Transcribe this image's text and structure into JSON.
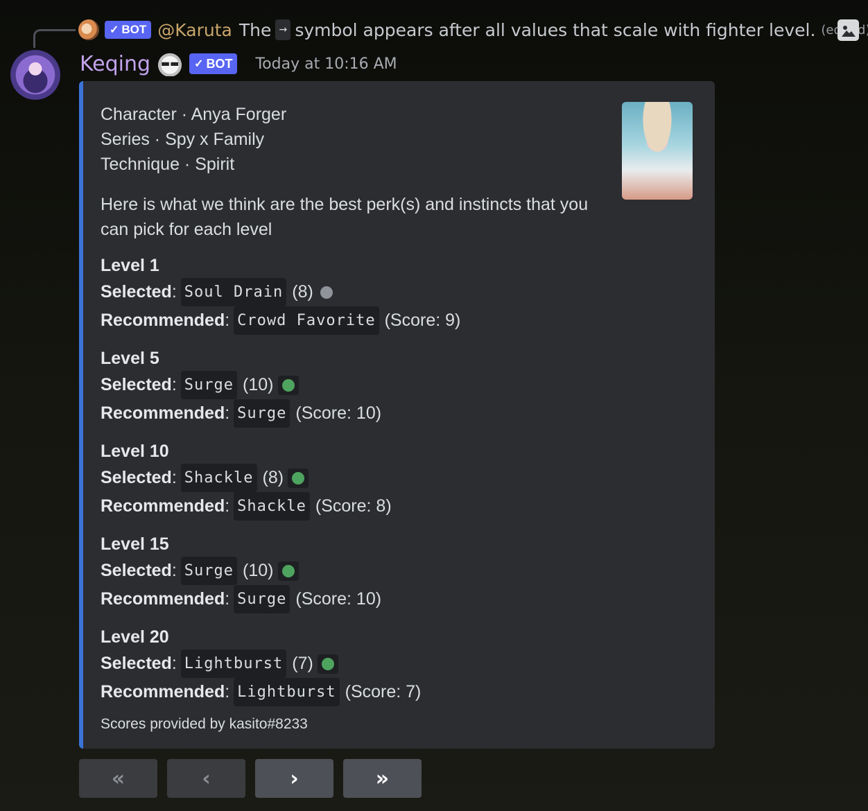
{
  "reply": {
    "bot_tag": "BOT",
    "mention": "@Karuta",
    "text_before": "The",
    "arrow_symbol": "→",
    "text_after": "symbol appears after all values that scale with fighter level.",
    "edited": "(edited)"
  },
  "message": {
    "author": "Keqing",
    "bot_tag": "BOT",
    "timestamp": "Today at 10:16 AM"
  },
  "embed": {
    "accent_color": "#3b73d6",
    "meta": [
      "Character · Anya Forger",
      "Series · Spy x Family",
      "Technique · Spirit"
    ],
    "intro": "Here is what we think are the best perk(s) and instincts that you can pick for each level",
    "levels": [
      {
        "title": "Level 1",
        "selected_label": "Selected",
        "selected": "Soul Drain",
        "selected_value": "(8)",
        "status": "gray",
        "recommended_label": "Recommended",
        "recommended": "Crowd Favorite",
        "score": "(Score: 9)"
      },
      {
        "title": "Level 5",
        "selected_label": "Selected",
        "selected": "Surge",
        "selected_value": "(10)",
        "status": "green",
        "recommended_label": "Recommended",
        "recommended": "Surge",
        "score": "(Score: 10)"
      },
      {
        "title": "Level 10",
        "selected_label": "Selected",
        "selected": "Shackle",
        "selected_value": "(8)",
        "status": "green",
        "recommended_label": "Recommended",
        "recommended": "Shackle",
        "score": "(Score: 8)"
      },
      {
        "title": "Level 15",
        "selected_label": "Selected",
        "selected": "Surge",
        "selected_value": "(10)",
        "status": "green",
        "recommended_label": "Recommended",
        "recommended": "Surge",
        "score": "(Score: 10)"
      },
      {
        "title": "Level 20",
        "selected_label": "Selected",
        "selected": "Lightburst",
        "selected_value": "(7)",
        "status": "green",
        "recommended_label": "Recommended",
        "recommended": "Lightburst",
        "score": "(Score: 7)"
      }
    ],
    "footer": "Scores provided by kasito#8233"
  },
  "status_colors": {
    "green": "#4ea45f",
    "gray": "#8f949c"
  },
  "buttons": [
    {
      "name": "first-page-button",
      "label": "«",
      "enabled": false
    },
    {
      "name": "previous-page-button",
      "label": "‹",
      "enabled": false
    },
    {
      "name": "next-page-button",
      "label": "›",
      "enabled": true
    },
    {
      "name": "last-page-button",
      "label": "»",
      "enabled": true
    }
  ]
}
